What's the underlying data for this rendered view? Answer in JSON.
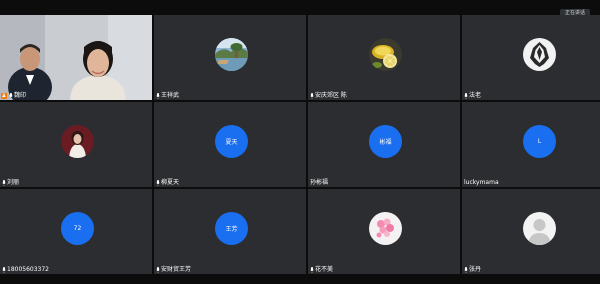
{
  "topbar": {
    "speaking_label": "正在讲话"
  },
  "colors": {
    "tile_bg": "#2b2d30",
    "avatar_blue": "#1a6ff0",
    "host_orange": "#f07a12"
  },
  "participants": [
    {
      "name": "魏印",
      "kind": "video",
      "mic": true,
      "host": true
    },
    {
      "name": "王祥武",
      "kind": "photo",
      "photo": "lake-photo",
      "mic": true
    },
    {
      "name": "安庆郊区 陈",
      "kind": "photo",
      "photo": "lemon-photo",
      "mic": true
    },
    {
      "name": "法老",
      "kind": "photo",
      "photo": "wolf-logo",
      "mic": true
    },
    {
      "name": "刘丽",
      "kind": "photo",
      "photo": "woman-portrait",
      "mic": true
    },
    {
      "name": "柳夏天",
      "kind": "initials",
      "initials": "夏天",
      "mic": true
    },
    {
      "name": "孙彬福",
      "kind": "initials",
      "initials": "彬福",
      "mic": false
    },
    {
      "name": "luckymama",
      "kind": "initials",
      "initials": "L",
      "mic": false
    },
    {
      "name": "18005603372",
      "kind": "initials",
      "initials": "72",
      "mic": true
    },
    {
      "name": "安财贸王芳",
      "kind": "initials",
      "initials": "王芳",
      "mic": true
    },
    {
      "name": "花不美",
      "kind": "photo",
      "photo": "pink-flower-photo",
      "mic": true
    },
    {
      "name": "张丹",
      "kind": "photo",
      "photo": "default-avatar",
      "mic": true
    }
  ]
}
